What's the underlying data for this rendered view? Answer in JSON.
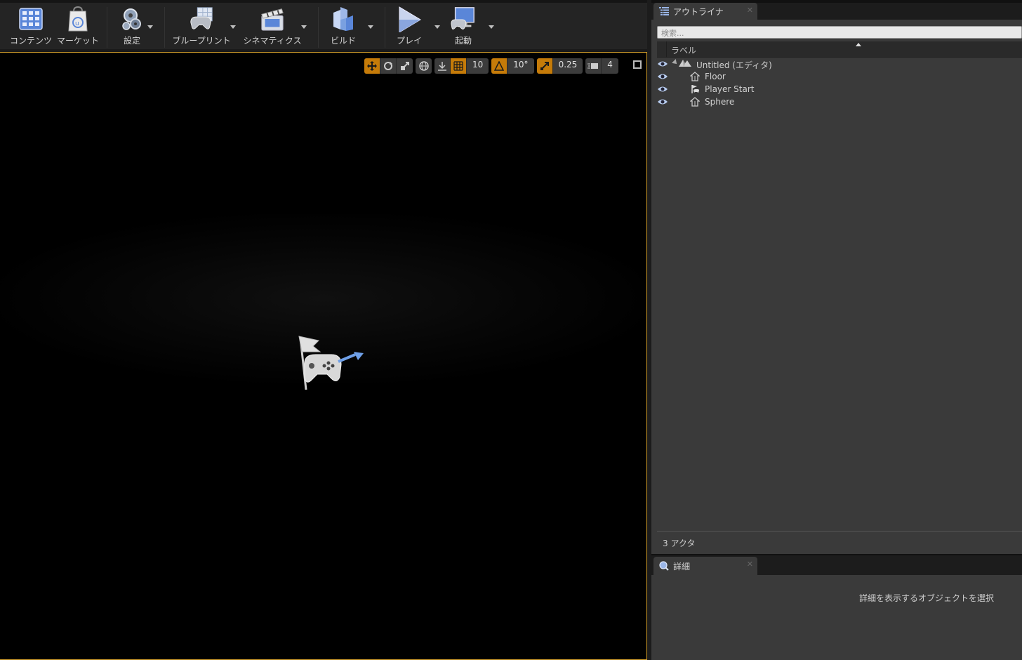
{
  "toolbar": {
    "items": [
      {
        "label": "コンテンツ",
        "icon": "content-grid-icon"
      },
      {
        "label": "マーケット",
        "icon": "marketplace-bag-icon"
      },
      {
        "label": "設定",
        "icon": "settings-gears-icon"
      },
      {
        "label": "ブループリント",
        "icon": "blueprint-controller-icon"
      },
      {
        "label": "シネマティクス",
        "icon": "cinematics-clapper-icon"
      },
      {
        "label": "ビルド",
        "icon": "build-blocks-icon"
      },
      {
        "label": "プレイ",
        "icon": "play-triangle-icon"
      },
      {
        "label": "起動",
        "icon": "launch-monitor-icon"
      }
    ]
  },
  "viewport": {
    "grid_snap": "10",
    "rotation_snap": "10°",
    "scale_snap": "0.25",
    "camera_speed": "4",
    "accent": "#d19d2a"
  },
  "outliner": {
    "tab_title": "アウトライナ",
    "search_placeholder": "検索...",
    "column_label": "ラベル",
    "root": "Untitled (エディタ)",
    "actors": [
      "Floor",
      "Player Start",
      "Sphere"
    ],
    "count": "3 アクタ"
  },
  "details": {
    "tab_title": "詳細",
    "empty_message": "詳細を表示するオブジェクトを選択"
  },
  "colors": {
    "active_orange": "#c57b09",
    "panel_bg": "#3a3a3a",
    "tab_bg": "#1c1c1c"
  }
}
